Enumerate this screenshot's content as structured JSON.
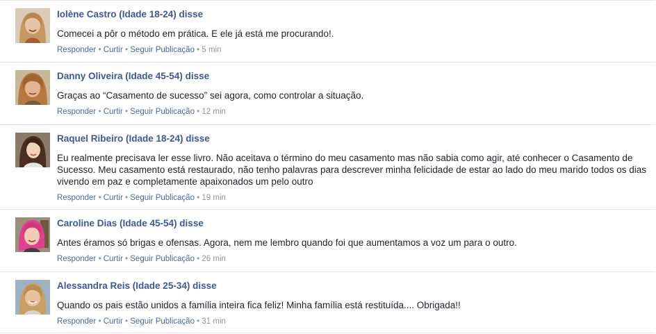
{
  "comments": [
    {
      "author": "Iolène Castro (Idade 18-24) disse",
      "text": "Comecei a pôr o método em prática. E ele já está me procurando!.",
      "actions": {
        "reply": "Responder",
        "like": "Curtir",
        "follow": "Seguir Publicação"
      },
      "time": "5 min"
    },
    {
      "author": "Danny Oliveira (Idade 45-54) disse",
      "text": "Graças ao “Casamento de sucesso” sei agora, como controlar a situação.",
      "actions": {
        "reply": "Responder",
        "like": "Curtir",
        "follow": "Seguir Publicação"
      },
      "time": "12 min"
    },
    {
      "author": "Raquel Ribeiro (Idade 18-24) disse",
      "text": "Eu realmente precisava ler esse livro. Não aceitava o término do meu casamento mas não sabia como agir, até conhecer o Casamento de Sucesso. Meu casamento está restaurado, não tenho palavras para descrever minha felicidade de estar ao lado do meu marido todos os dias vivendo em paz e completamente apaixonados um pelo outro",
      "actions": {
        "reply": "Responder",
        "like": "Curtir",
        "follow": "Seguir Publicação"
      },
      "time": "19 min"
    },
    {
      "author": "Caroline Dias (Idade 45-54) disse",
      "text": "Antes éramos só brigas e ofensas. Agora, nem me lembro quando foi que aumentamos a voz um para o outro.",
      "actions": {
        "reply": "Responder",
        "like": "Curtir",
        "follow": "Seguir Publicação"
      },
      "time": "26 min"
    },
    {
      "author": "Alessandra Reis (Idade 25-34) disse",
      "text": "Quando os pais estão unidos a família inteira fica feliz! Minha família está restituída.... Obrigada!!",
      "actions": {
        "reply": "Responder",
        "like": "Curtir",
        "follow": "Seguir Publicação"
      },
      "time": "31 min"
    }
  ],
  "colors": {
    "author": "#3b5998",
    "link": "#4b67a1",
    "meta": "#90949c",
    "text": "#1d2129",
    "divider": "#e3e5e9"
  }
}
